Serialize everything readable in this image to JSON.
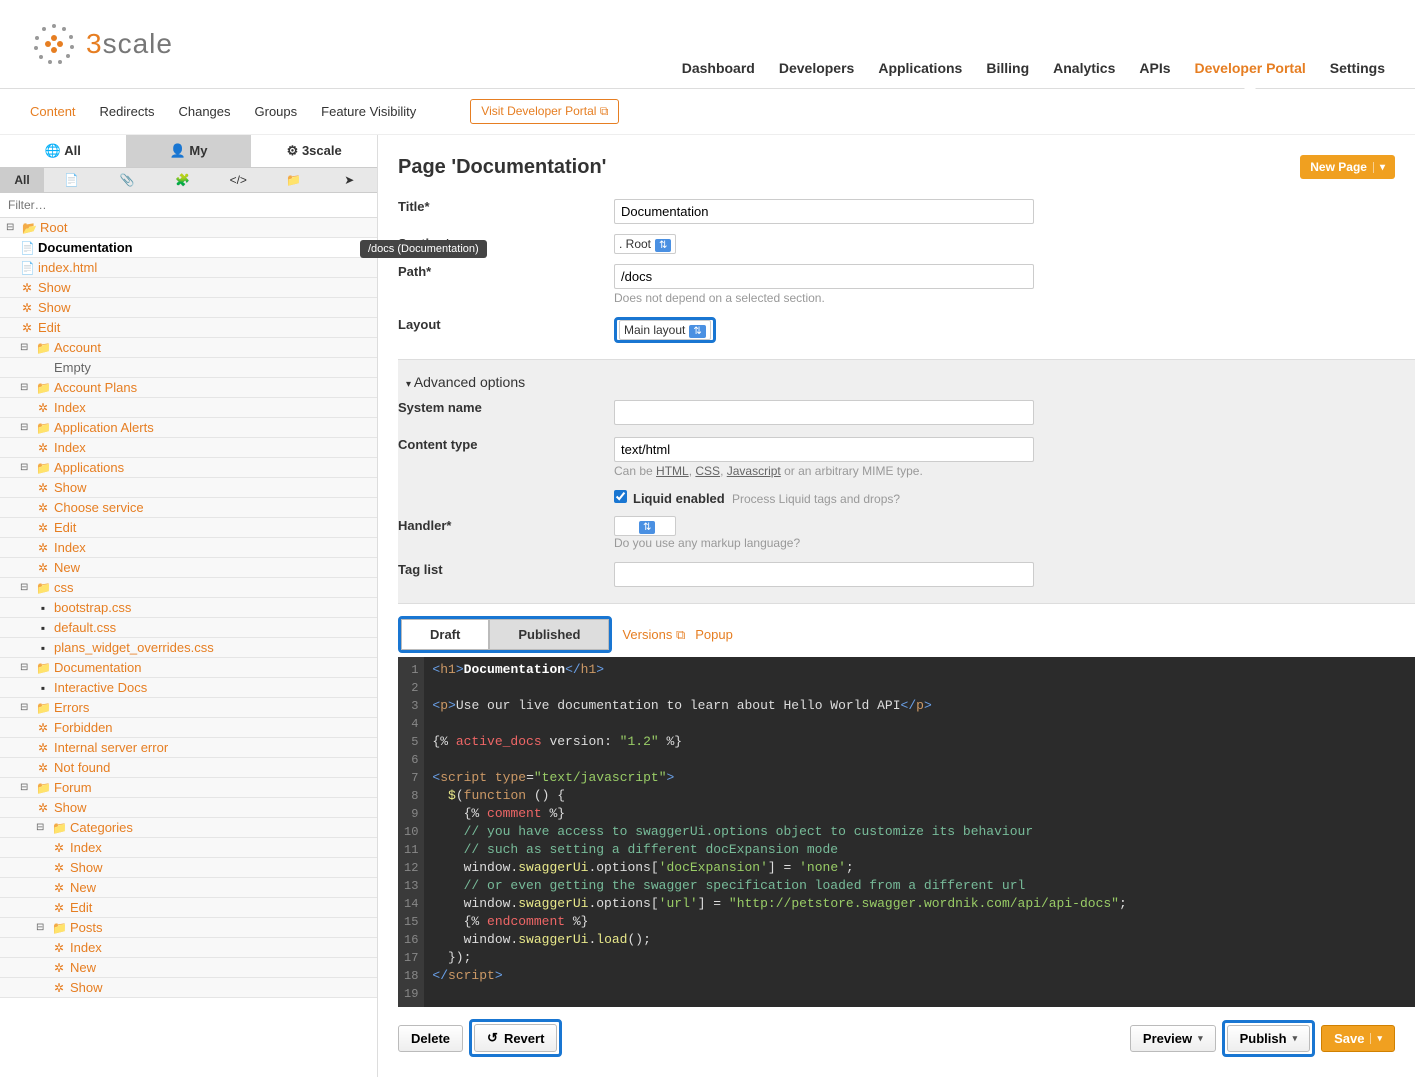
{
  "logo_text": "3scale",
  "topnav": [
    "Dashboard",
    "Developers",
    "Applications",
    "Billing",
    "Analytics",
    "APIs",
    "Developer Portal",
    "Settings"
  ],
  "topnav_active": 6,
  "subnav": [
    "Content",
    "Redirects",
    "Changes",
    "Groups",
    "Feature Visibility"
  ],
  "subnav_active": 0,
  "visit_label": "Visit Developer Portal",
  "side_tabs": [
    "All",
    "My",
    "3scale"
  ],
  "icon_tabs_first": "All",
  "filter_placeholder": "Filter…",
  "tooltip": "/docs (Documentation)",
  "tree": [
    {
      "d": 0,
      "t": "folder-open",
      "lbl": "Root",
      "exp": "minus",
      "cls": ""
    },
    {
      "d": 1,
      "t": "file",
      "lbl": "Documentation",
      "cls": "selected"
    },
    {
      "d": 1,
      "t": "file",
      "lbl": "index.html"
    },
    {
      "d": 1,
      "t": "gear",
      "lbl": "Show"
    },
    {
      "d": 1,
      "t": "gear",
      "lbl": "Show"
    },
    {
      "d": 1,
      "t": "gear",
      "lbl": "Edit"
    },
    {
      "d": 1,
      "t": "folder",
      "lbl": "Account",
      "exp": "minus"
    },
    {
      "d": 2,
      "t": "",
      "lbl": "Empty",
      "cls": "muted"
    },
    {
      "d": 1,
      "t": "folder",
      "lbl": "Account Plans",
      "exp": "minus"
    },
    {
      "d": 2,
      "t": "gear",
      "lbl": "Index"
    },
    {
      "d": 1,
      "t": "folder",
      "lbl": "Application Alerts",
      "exp": "minus"
    },
    {
      "d": 2,
      "t": "gear",
      "lbl": "Index"
    },
    {
      "d": 1,
      "t": "folder",
      "lbl": "Applications",
      "exp": "minus"
    },
    {
      "d": 2,
      "t": "gear",
      "lbl": "Show"
    },
    {
      "d": 2,
      "t": "gear",
      "lbl": "Choose service"
    },
    {
      "d": 2,
      "t": "gear",
      "lbl": "Edit"
    },
    {
      "d": 2,
      "t": "gear",
      "lbl": "Index"
    },
    {
      "d": 2,
      "t": "gear",
      "lbl": "New"
    },
    {
      "d": 1,
      "t": "folder",
      "lbl": "css",
      "exp": "minus"
    },
    {
      "d": 2,
      "t": "file-dark",
      "lbl": "bootstrap.css"
    },
    {
      "d": 2,
      "t": "file-dark",
      "lbl": "default.css"
    },
    {
      "d": 2,
      "t": "file-dark",
      "lbl": "plans_widget_overrides.css"
    },
    {
      "d": 1,
      "t": "folder",
      "lbl": "Documentation",
      "exp": "minus"
    },
    {
      "d": 2,
      "t": "file-dark",
      "lbl": "Interactive Docs"
    },
    {
      "d": 1,
      "t": "folder",
      "lbl": "Errors",
      "exp": "minus"
    },
    {
      "d": 2,
      "t": "gear",
      "lbl": "Forbidden"
    },
    {
      "d": 2,
      "t": "gear",
      "lbl": "Internal server error"
    },
    {
      "d": 2,
      "t": "gear",
      "lbl": "Not found"
    },
    {
      "d": 1,
      "t": "folder",
      "lbl": "Forum",
      "exp": "minus"
    },
    {
      "d": 2,
      "t": "gear",
      "lbl": "Show"
    },
    {
      "d": 2,
      "t": "folder",
      "lbl": "Categories",
      "exp": "minus"
    },
    {
      "d": 3,
      "t": "gear",
      "lbl": "Index"
    },
    {
      "d": 3,
      "t": "gear",
      "lbl": "Show"
    },
    {
      "d": 3,
      "t": "gear",
      "lbl": "New"
    },
    {
      "d": 3,
      "t": "gear",
      "lbl": "Edit"
    },
    {
      "d": 2,
      "t": "folder",
      "lbl": "Posts",
      "exp": "minus"
    },
    {
      "d": 3,
      "t": "gear",
      "lbl": "Index"
    },
    {
      "d": 3,
      "t": "gear",
      "lbl": "New"
    },
    {
      "d": 3,
      "t": "gear",
      "lbl": "Show"
    }
  ],
  "page_title": "Page 'Documentation'",
  "new_page_label": "New Page",
  "form": {
    "title_label": "Title*",
    "title_value": "Documentation",
    "section_label": "Section*",
    "section_value": ". Root",
    "path_label": "Path*",
    "path_value": "/docs",
    "path_help": "Does not depend on a selected section.",
    "layout_label": "Layout",
    "layout_value": "Main layout",
    "adv_header": "Advanced options",
    "system_name_label": "System name",
    "content_type_label": "Content type",
    "content_type_value": "text/html",
    "content_type_help_pre": "Can be ",
    "content_type_help_html": "HTML",
    "content_type_help_css": "CSS",
    "content_type_help_js": "Javascript",
    "content_type_help_post": " or an arbitrary MIME type.",
    "liquid_label": "Liquid enabled",
    "liquid_help": "Process Liquid tags and drops?",
    "handler_label": "Handler*",
    "handler_help": "Do you use any markup language?",
    "taglist_label": "Tag list"
  },
  "editor": {
    "tab_draft": "Draft",
    "tab_published": "Published",
    "versions": "Versions",
    "popup": "Popup",
    "lines": 19
  },
  "buttons": {
    "delete": "Delete",
    "revert": "Revert",
    "preview": "Preview",
    "publish": "Publish",
    "save": "Save"
  }
}
